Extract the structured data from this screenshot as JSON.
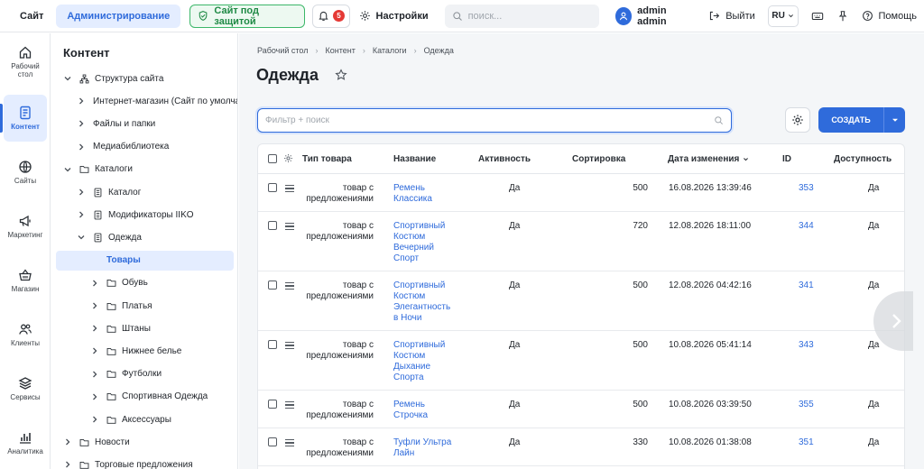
{
  "topbar": {
    "site": "Сайт",
    "admin": "Администрирование",
    "secure": "Сайт под защитой",
    "notifications_count": "5",
    "settings": "Настройки",
    "search_placeholder": "поиск...",
    "user": "admin admin",
    "exit": "Выйти",
    "lang": "RU",
    "help": "Помощь"
  },
  "rail": [
    {
      "label": "Рабочий стол",
      "icon": "home-icon"
    },
    {
      "label": "Контент",
      "icon": "document-icon",
      "active": true
    },
    {
      "label": "Сайты",
      "icon": "globe-icon"
    },
    {
      "label": "Маркетинг",
      "icon": "megaphone-icon"
    },
    {
      "label": "Магазин",
      "icon": "basket-icon"
    },
    {
      "label": "Клиенты",
      "icon": "users-icon"
    },
    {
      "label": "Сервисы",
      "icon": "layers-icon"
    },
    {
      "label": "Аналитика",
      "icon": "chart-icon"
    }
  ],
  "tree": {
    "title": "Контент",
    "items": [
      {
        "label": "Структура сайта",
        "icon": "sitemap-icon"
      },
      {
        "label": "Интернет-магазин (Сайт по умолча",
        "icon": ""
      },
      {
        "label": "Файлы и папки",
        "icon": ""
      },
      {
        "label": "Медиабиблиотека",
        "icon": ""
      },
      {
        "label": "Каталоги",
        "icon": "folder-icon"
      },
      {
        "label": "Каталог",
        "icon": "doc-icon"
      },
      {
        "label": "Модификаторы IIKO",
        "icon": "doc-icon"
      },
      {
        "label": "Одежда",
        "icon": "doc-icon"
      },
      {
        "label": "Товары",
        "icon": ""
      },
      {
        "label": "Обувь",
        "icon": "folder-icon"
      },
      {
        "label": "Платья",
        "icon": "folder-icon"
      },
      {
        "label": "Штаны",
        "icon": "folder-icon"
      },
      {
        "label": "Нижнее белье",
        "icon": "folder-icon"
      },
      {
        "label": "Футболки",
        "icon": "folder-icon"
      },
      {
        "label": "Спортивная Одежда",
        "icon": "folder-icon"
      },
      {
        "label": "Аксессуары",
        "icon": "folder-icon"
      },
      {
        "label": "Новости",
        "icon": "folder-icon"
      },
      {
        "label": "Торговые предложения",
        "icon": "folder-icon"
      }
    ]
  },
  "breadcrumbs": [
    "Рабочий стол",
    "Контент",
    "Каталоги",
    "Одежда"
  ],
  "page_title": "Одежда",
  "filter_placeholder": "Фильтр + поиск",
  "create_label": "СОЗДАТЬ",
  "table": {
    "headers": {
      "type": "Тип товара",
      "name": "Название",
      "active": "Активность",
      "sort": "Сортировка",
      "date": "Дата изменения",
      "id": "ID",
      "availability": "Доступность"
    },
    "rows": [
      {
        "type": [
          "товар с",
          "предложениями"
        ],
        "name": [
          "Ремень",
          "Классика"
        ],
        "active": "Да",
        "sort": "500",
        "date": "16.08.2026 13:39:46",
        "id": "353",
        "availability": "Да"
      },
      {
        "type": [
          "товар с",
          "предложениями"
        ],
        "name": [
          "Спортивный",
          "Костюм",
          "Вечерний",
          "Спорт"
        ],
        "active": "Да",
        "sort": "720",
        "date": "12.08.2026 18:11:00",
        "id": "344",
        "availability": "Да"
      },
      {
        "type": [
          "товар с",
          "предложениями"
        ],
        "name": [
          "Спортивный",
          "Костюм",
          "Элегантность",
          "в Ночи"
        ],
        "active": "Да",
        "sort": "500",
        "date": "12.08.2026 04:42:16",
        "id": "341",
        "availability": "Да"
      },
      {
        "type": [
          "товар с",
          "предложениями"
        ],
        "name": [
          "Спортивный",
          "Костюм",
          "Дыхание",
          "Спорта"
        ],
        "active": "Да",
        "sort": "500",
        "date": "10.08.2026 05:41:14",
        "id": "343",
        "availability": "Да"
      },
      {
        "type": [
          "товар с",
          "предложениями"
        ],
        "name": [
          "Ремень",
          "Строчка"
        ],
        "active": "Да",
        "sort": "500",
        "date": "10.08.2026 03:39:50",
        "id": "355",
        "availability": "Да"
      },
      {
        "type": [
          "товар с",
          "предложениями"
        ],
        "name": [
          "Туфли Ультра",
          "Лайн"
        ],
        "active": "Да",
        "sort": "330",
        "date": "10.08.2026 01:38:08",
        "id": "351",
        "availability": "Да"
      }
    ]
  }
}
